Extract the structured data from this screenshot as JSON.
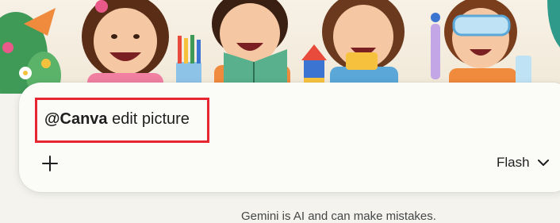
{
  "banner": {
    "description_icon": "children-illustration"
  },
  "prompt": {
    "mention": "@Canva",
    "text": " edit picture"
  },
  "toolbar": {
    "add_icon": "plus-icon",
    "model_label": "Flash",
    "model_icon": "chevron-down-icon"
  },
  "footer": {
    "disclaimer": "Gemini is AI and can make mistakes."
  },
  "colors": {
    "highlight": "#e8262f",
    "card": "#fbfbf8",
    "page": "#f4f3ee"
  }
}
